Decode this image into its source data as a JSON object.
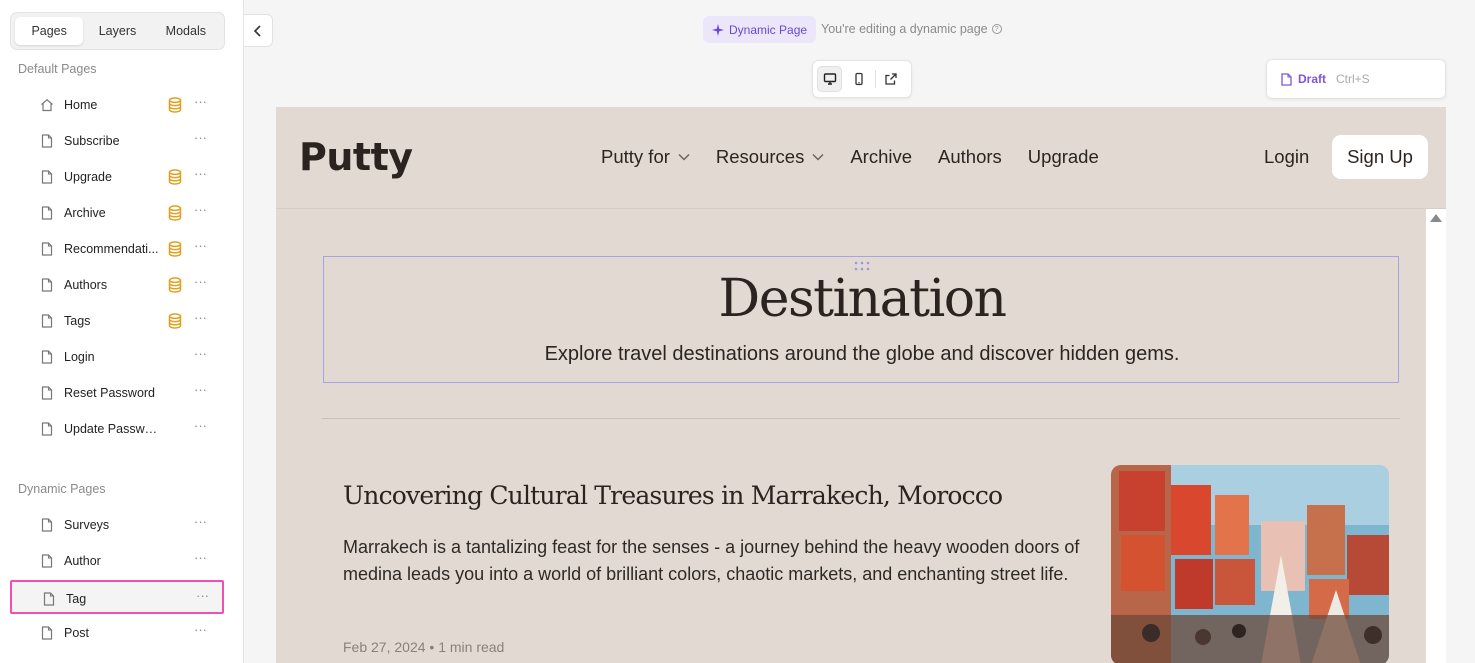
{
  "sidebar": {
    "tabs": [
      {
        "label": "Pages"
      },
      {
        "label": "Layers"
      },
      {
        "label": "Modals"
      }
    ],
    "default_title": "Default Pages",
    "default_pages": [
      {
        "label": "Home",
        "icon": "home-icon",
        "cms": true
      },
      {
        "label": "Subscribe",
        "icon": "page-icon",
        "cms": false
      },
      {
        "label": "Upgrade",
        "icon": "page-icon",
        "cms": true
      },
      {
        "label": "Archive",
        "icon": "page-icon",
        "cms": true
      },
      {
        "label": "Recommendati...",
        "icon": "page-icon",
        "cms": true
      },
      {
        "label": "Authors",
        "icon": "page-icon",
        "cms": true
      },
      {
        "label": "Tags",
        "icon": "page-icon",
        "cms": true
      },
      {
        "label": "Login",
        "icon": "page-icon",
        "cms": false
      },
      {
        "label": "Reset Password",
        "icon": "page-icon",
        "cms": false
      },
      {
        "label": "Update Password",
        "icon": "page-icon",
        "cms": false
      }
    ],
    "dynamic_title": "Dynamic Pages",
    "dynamic_pages": [
      {
        "label": "Surveys",
        "icon": "page-icon"
      },
      {
        "label": "Author",
        "icon": "page-icon"
      },
      {
        "label": "Tag",
        "icon": "page-icon",
        "selected": true
      },
      {
        "label": "Post",
        "icon": "page-icon"
      }
    ],
    "more_glyph": "···"
  },
  "topbar": {
    "badge_label": "Dynamic Page",
    "editing_text": "You're editing a dynamic page",
    "help_glyph": "?",
    "draft_label": "Draft",
    "draft_shortcut": "Ctrl+S"
  },
  "site": {
    "logo": "Putty",
    "nav": [
      "Putty for",
      "Resources",
      "Archive",
      "Authors",
      "Upgrade"
    ],
    "login": "Login",
    "signup": "Sign Up",
    "hero_title": "Destination",
    "hero_subtitle": "Explore travel destinations around the globe and discover hidden gems.",
    "post": {
      "title": "Uncovering Cultural Treasures in Marrakech, Morocco",
      "excerpt": "Marrakech is a tantalizing feast for the senses - a journey behind the heavy wooden doors of medina leads you into a world of brilliant colors, chaotic markets, and enchanting street life.",
      "date": "Feb 27, 2024",
      "separator": "•",
      "read_time": "1 min read"
    }
  },
  "colors": {
    "accent": "#7c55e0",
    "canvas_bg": "#e2dad2",
    "selection_outline": "#f24fb3",
    "cms_icon": "#e0a020"
  }
}
